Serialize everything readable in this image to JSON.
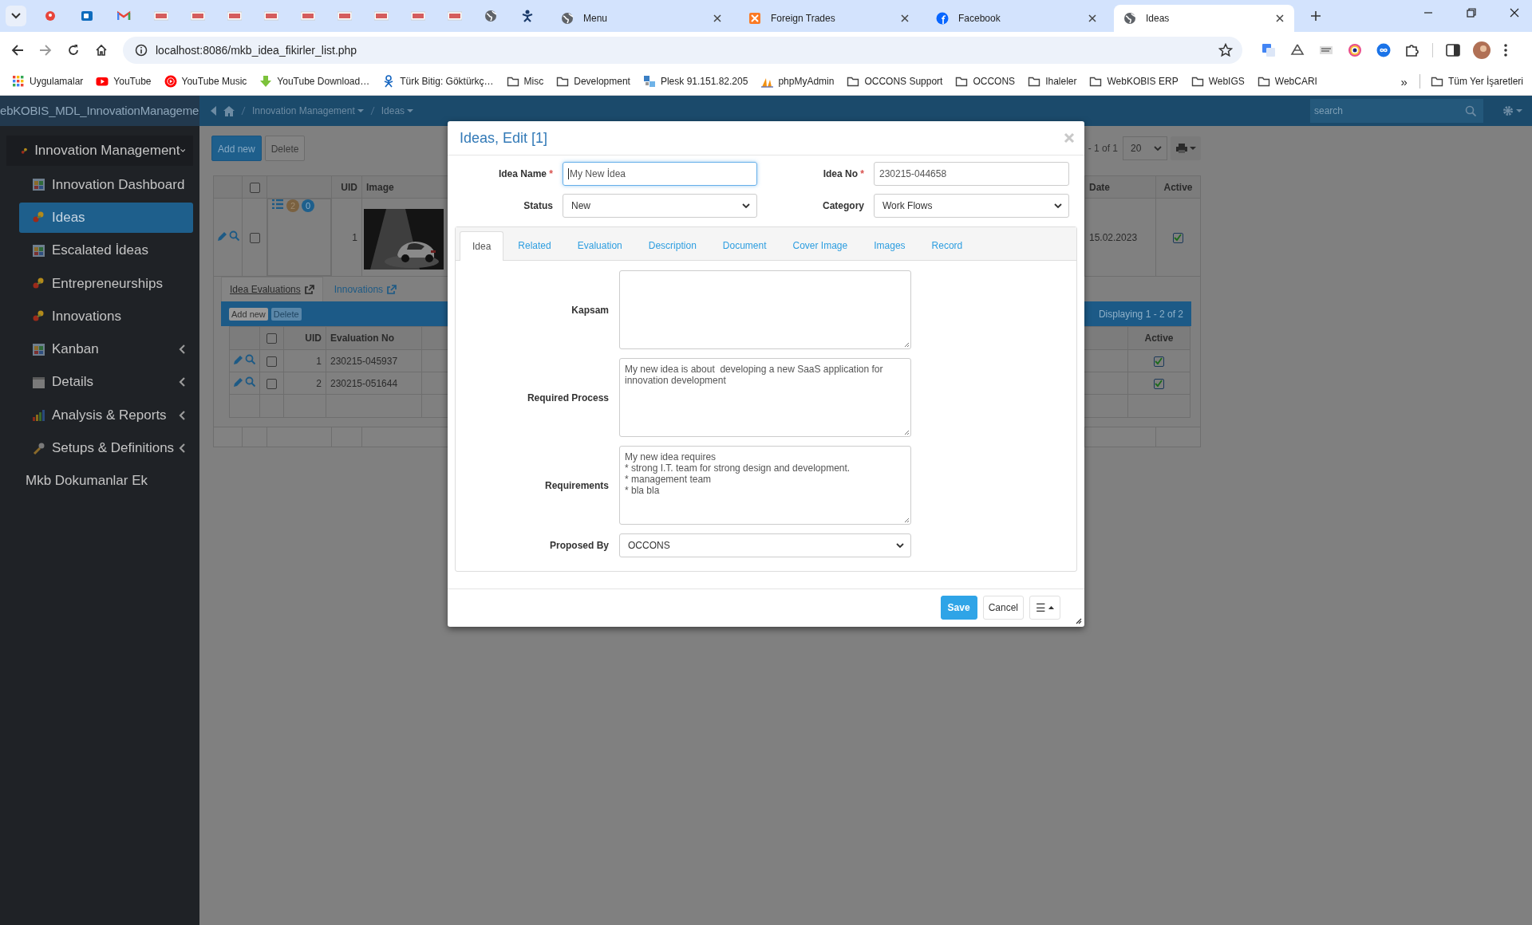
{
  "browser": {
    "pinned_tabs": [
      {
        "kind": "red-dot",
        "selected": false
      },
      {
        "kind": "blue-square",
        "selected": false
      },
      {
        "kind": "envelope",
        "selected": false
      },
      {
        "kind": "logo",
        "selected": false
      },
      {
        "kind": "logo",
        "selected": false
      },
      {
        "kind": "logo",
        "selected": false
      },
      {
        "kind": "logo",
        "selected": false
      },
      {
        "kind": "logo",
        "selected": false
      },
      {
        "kind": "logo",
        "selected": false
      },
      {
        "kind": "logo",
        "selected": false
      },
      {
        "kind": "logo",
        "selected": false
      },
      {
        "kind": "logo",
        "selected": false
      },
      {
        "kind": "globe",
        "selected": false
      },
      {
        "kind": "figure",
        "selected": false
      }
    ],
    "tabs": [
      {
        "kind": "globe",
        "title": "Menu",
        "selected": false
      },
      {
        "kind": "tile",
        "title": "Foreign Trades",
        "selected": false
      },
      {
        "kind": "circle",
        "title": "Facebook",
        "selected": false
      },
      {
        "kind": "globe",
        "title": "Ideas",
        "selected": true
      }
    ],
    "url": "localhost:8086/mkb_idea_fikirler_list.php",
    "bookmarks": [
      {
        "kind": "apps",
        "label": "Uygulamalar"
      },
      {
        "kind": "video",
        "label": "YouTube"
      },
      {
        "kind": "music",
        "label": "YouTube Music"
      },
      {
        "kind": "download",
        "label": "YouTube Download…"
      },
      {
        "kind": "figure",
        "label": "Türk Bitig: Göktürkç…"
      },
      {
        "kind": "folder",
        "label": "Misc"
      },
      {
        "kind": "folder",
        "label": "Development"
      },
      {
        "kind": "server",
        "label": "Plesk 91.151.82.205"
      },
      {
        "kind": "sail",
        "label": "phpMyAdmin"
      },
      {
        "kind": "folder",
        "label": "OCCONS Support"
      },
      {
        "kind": "folder",
        "label": "OCCONS"
      },
      {
        "kind": "folder",
        "label": "Ihaleler"
      },
      {
        "kind": "folder",
        "label": "WebKOBIS ERP"
      },
      {
        "kind": "folder",
        "label": "WebIGS"
      },
      {
        "kind": "folder",
        "label": "WebCARI"
      }
    ],
    "more_bookmarks": "»",
    "all_bookmarks": "Tüm Yer İşaretleri"
  },
  "app": {
    "brand": "ebKOBIS_MDL_InnovationManageme",
    "breadcrumb": [
      {
        "label": "Innovation Management"
      },
      {
        "label": "Ideas"
      }
    ],
    "search": {
      "placeholder": "search"
    }
  },
  "sidebar": {
    "items": [
      {
        "label": "Innovation Management",
        "kind": "people",
        "selected": false,
        "expanded": true,
        "children": [
          {
            "label": "Innovation Dashboard",
            "kind": "table",
            "selected": false
          },
          {
            "label": "Ideas",
            "kind": "people",
            "selected": true
          },
          {
            "label": "Escalated İdeas",
            "kind": "table",
            "selected": false
          },
          {
            "label": "Entrepreneurships",
            "kind": "people",
            "selected": false
          },
          {
            "label": "Innovations",
            "kind": "people",
            "selected": false
          },
          {
            "label": "Kanban",
            "kind": "table",
            "selected": false,
            "expanded": false
          },
          {
            "label": "Details",
            "kind": "calendar",
            "selected": false,
            "expanded": false
          },
          {
            "label": "Analysis & Reports",
            "kind": "chart",
            "selected": false,
            "expanded": false
          },
          {
            "label": "Setups & Definitions",
            "kind": "wrench",
            "selected": false,
            "expanded": false
          }
        ]
      },
      {
        "label": "Mkb Dokumanlar Ek",
        "kind": "plain",
        "selected": false
      }
    ]
  },
  "list": {
    "buttons": [
      {
        "label": "Add new",
        "kind": "primary"
      },
      {
        "label": "Delete",
        "kind": "default"
      }
    ],
    "pager": "- 1 of 1",
    "page_size": "20",
    "select_all": false,
    "columns": [
      "UID",
      "Image",
      "Date",
      "Active"
    ],
    "rows": [
      {
        "selected": false,
        "badges": [
          {
            "kind": "warning",
            "text": "2"
          },
          {
            "kind": "info",
            "text": "0"
          }
        ],
        "uid": "1",
        "image": {
          "kind": "picture"
        },
        "date": "15.02.2023",
        "active": true
      }
    ],
    "detail_tabs": [
      {
        "label": "Idea Evaluations",
        "selected": true
      },
      {
        "label": "Innovations",
        "selected": false
      }
    ],
    "subgrid": {
      "buttons": [
        {
          "label": "Add new",
          "disabled": false
        },
        {
          "label": "Delete",
          "disabled": true
        }
      ],
      "status": "Displaying 1 - 2 of 2",
      "select_all": false,
      "columns": [
        "UID",
        "Evaluation No",
        "Active"
      ],
      "rows": [
        {
          "selected": false,
          "uid": "1",
          "evaluation_no": "230215-045937",
          "active": true
        },
        {
          "selected": false,
          "uid": "2",
          "evaluation_no": "230215-051644",
          "active": true
        }
      ]
    }
  },
  "modal": {
    "title": "Ideas, Edit [1]",
    "header_fields": [
      {
        "label": "Idea Name",
        "required_mark": "*",
        "kind": "input",
        "value": "My New İdea",
        "focused": true
      },
      {
        "label": "Idea No",
        "required_mark": "*",
        "kind": "input",
        "value": "230215-044658",
        "focused": false
      },
      {
        "label": "Status",
        "kind": "select",
        "value": "New"
      },
      {
        "label": "Category",
        "kind": "select",
        "value": "Work Flows"
      }
    ],
    "tabs": [
      {
        "label": "Idea",
        "selected": true
      },
      {
        "label": "Related",
        "selected": false
      },
      {
        "label": "Evaluation",
        "selected": false
      },
      {
        "label": "Description",
        "selected": false
      },
      {
        "label": "Document",
        "selected": false
      },
      {
        "label": "Cover Image",
        "selected": false
      },
      {
        "label": "Images",
        "selected": false
      },
      {
        "label": "Record",
        "selected": false
      }
    ],
    "fields": [
      {
        "label": "Kapsam",
        "kind": "textarea"
      },
      {
        "label": "Required Process",
        "kind": "textarea",
        "value": "My new idea is about  developing a new SaaS application for innovation development"
      },
      {
        "label": "Requirements",
        "kind": "textarea",
        "value": "My new idea requires\n* strong I.T. team for strong design and development.\n* management team\n* bla bla"
      },
      {
        "label": "Proposed By",
        "kind": "select",
        "value": "OCCONS"
      }
    ],
    "buttons": [
      {
        "label": "Save",
        "kind": "primary"
      },
      {
        "label": "Cancel",
        "kind": "default"
      },
      {
        "label": "☰",
        "kind": "menu"
      }
    ]
  }
}
